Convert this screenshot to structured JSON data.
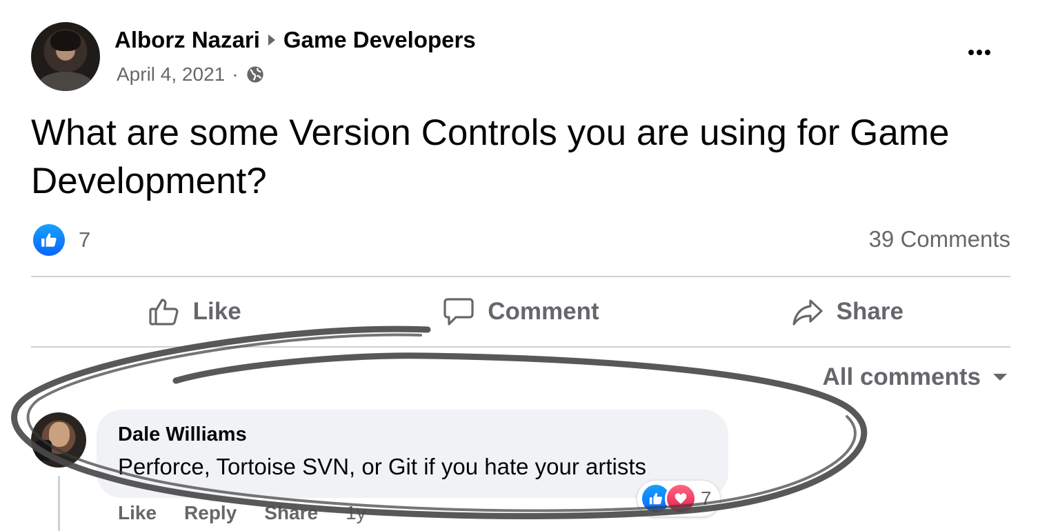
{
  "post": {
    "author": "Alborz Nazari",
    "group": "Game Developers",
    "date": "April 4, 2021",
    "separator": "·",
    "visibility_icon": "globe-icon",
    "more_icon": "more-options-icon",
    "text": "What are some Version Controls you are using for Game Development?",
    "reaction_icon": "like-icon",
    "reaction_count": "7",
    "comments_count": "39 Comments"
  },
  "actions": {
    "like": "Like",
    "comment": "Comment",
    "share": "Share"
  },
  "filter": {
    "label": "All comments"
  },
  "comment": {
    "author": "Dale Williams",
    "text": "Perforce, Tortoise SVN, or Git if you hate your artists",
    "like": "Like",
    "reply": "Reply",
    "share": "Share",
    "time": "1y",
    "reaction_count": "7"
  },
  "colors": {
    "secondary_text": "#65676b",
    "like_blue": "#0866ff",
    "love_red": "#e61e4d",
    "bubble_bg": "#f0f2f5",
    "annotation_stroke": "#4a4a4a"
  }
}
